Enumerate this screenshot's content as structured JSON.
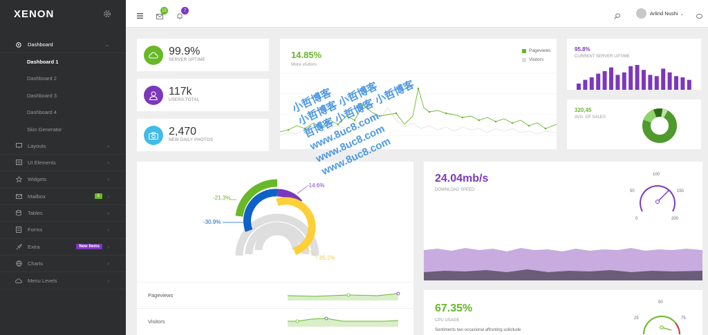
{
  "brand": {
    "logo": "XENON"
  },
  "sidebar": {
    "items": [
      {
        "label": "Dashboard",
        "icon": "dashboard-icon",
        "active": true
      },
      {
        "label": "Dashboard 1",
        "sub": true,
        "current": true
      },
      {
        "label": "Dashboard 2",
        "sub": true
      },
      {
        "label": "Dashboard 3",
        "sub": true
      },
      {
        "label": "Dashboard 4",
        "sub": true
      },
      {
        "label": "Skin Generator",
        "sub": true
      },
      {
        "label": "Layouts",
        "icon": "monitor-icon"
      },
      {
        "label": "UI Elements",
        "icon": "list-icon"
      },
      {
        "label": "Widgets",
        "icon": "star-icon"
      },
      {
        "label": "Mailbox",
        "icon": "mail-icon",
        "badge": "5"
      },
      {
        "label": "Tables",
        "icon": "database-icon"
      },
      {
        "label": "Forms",
        "icon": "form-icon"
      },
      {
        "label": "Extra",
        "icon": "rocket-icon",
        "badge_purple": "New Items"
      },
      {
        "label": "Charts",
        "icon": "globe-icon"
      },
      {
        "label": "Menu Levels",
        "icon": "cloud-icon"
      }
    ]
  },
  "topbar": {
    "messages_count": "15",
    "notifications_count": "7",
    "user_name": "Arlind Nushi"
  },
  "stats": [
    {
      "value": "99.9%",
      "label": "SERVER UPTIME",
      "color": "#68b828",
      "icon": "cloud-icon"
    },
    {
      "value": "117k",
      "label": "USERS TOTAL",
      "color": "#7c38bc",
      "icon": "user-icon"
    },
    {
      "value": "2,470",
      "label": "NEW DAILY PHOTOS",
      "color": "#40bbea",
      "icon": "camera-icon"
    }
  ],
  "visitors_card": {
    "value": "14.85%",
    "label": "More visitors",
    "legend": [
      "Pageviews",
      "Visitors"
    ]
  },
  "uptime_card": {
    "value": "95.8%",
    "label": "CURRENT SERVER UPTIME",
    "bar_heights": [
      0.25,
      0.4,
      0.5,
      0.65,
      0.75,
      0.9,
      0.6,
      0.7,
      0.95,
      1.0,
      0.8,
      0.6,
      0.55,
      0.85,
      0.7,
      0.55,
      0.5,
      0.4
    ]
  },
  "sales_card": {
    "value": "320,45",
    "label": "AVG. OF SALES"
  },
  "radial_card": {
    "labels": {
      "a": "-21.3%",
      "b": "-30.9%",
      "c": "-14.6%",
      "d": "85.2%"
    },
    "rows": [
      {
        "label": "Pageviews"
      },
      {
        "label": "Visitors"
      }
    ]
  },
  "download_card": {
    "value": "24.04mb/s",
    "label": "DOWNLOAD SPEED",
    "gauge": {
      "ticks": [
        "0",
        "50",
        "100",
        "150",
        "200"
      ]
    }
  },
  "cpu_card": {
    "value": "67.35%",
    "label": "CPU USAGE",
    "desc": "Sentiments two occasional affronting solicitude",
    "gauge": {
      "ticks": [
        "25",
        "50",
        "75"
      ]
    }
  },
  "watermark": [
    "小哲博客",
    "小哲博客 小哲博客",
    "哲博客 小哲博客 小哲博客",
    "www.8uc8.com",
    "www.8uc8.com",
    "www.8uc8.com"
  ],
  "colors": {
    "green": "#68b828",
    "purple": "#7c38bc",
    "blue": "#40bbea",
    "dark_blue": "#0e62c7",
    "yellow": "#fcd036"
  }
}
